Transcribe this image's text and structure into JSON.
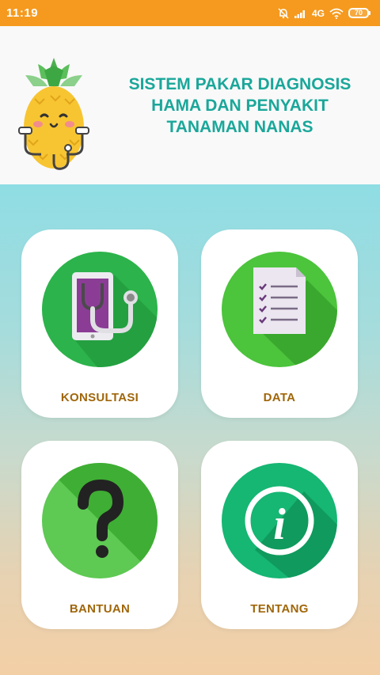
{
  "status_bar": {
    "time": "11:19",
    "network": "4G",
    "battery": "70"
  },
  "header": {
    "title_lines": [
      "SISTEM PAKAR DIAGNOSIS",
      "HAMA DAN PENYAKIT",
      "TANAMAN NANAS"
    ],
    "logo_icon": "pineapple-doctor-icon"
  },
  "menu": [
    {
      "label": "KONSULTASI",
      "icon": "stethoscope-tablet-icon"
    },
    {
      "label": "DATA",
      "icon": "checklist-document-icon"
    },
    {
      "label": "BANTUAN",
      "icon": "question-mark-icon"
    },
    {
      "label": "TENTANG",
      "icon": "info-icon"
    }
  ],
  "colors": {
    "status_bar": "#f59a1e",
    "title": "#1aa79a",
    "label": "#a0660a",
    "green_circle": "#2bb34c",
    "teal_circle": "#17b877"
  }
}
